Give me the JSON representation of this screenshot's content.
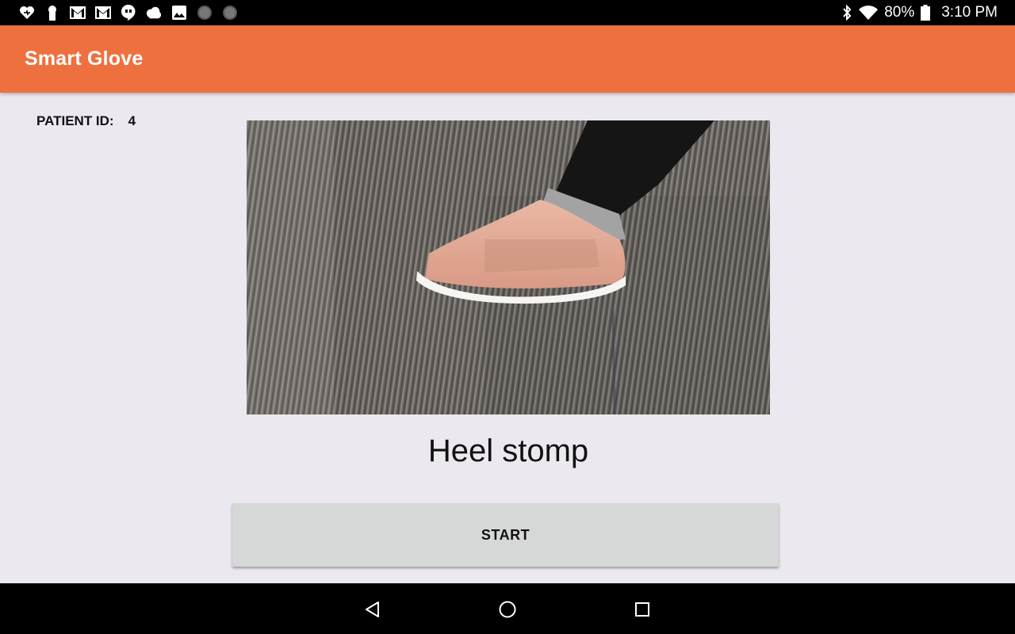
{
  "status_bar": {
    "notification_icons": [
      "heart-icon",
      "keyhole-icon",
      "gmail-icon",
      "gmail-icon",
      "hangouts-icon",
      "cloud-icon",
      "image-icon",
      "circle-icon",
      "circle-icon"
    ],
    "battery": "80%",
    "time": "3:10 PM"
  },
  "app_bar": {
    "title": "Smart Glove",
    "color": "#ef703f"
  },
  "main": {
    "patient_label": "PATIENT ID:",
    "patient_id": "4",
    "image_subject": "foot-in-pink-sneaker-on-carpet",
    "exercise_name": "Heel stomp",
    "start_label": "START"
  },
  "nav_bar": {
    "icons": [
      "back-icon",
      "home-icon",
      "recents-icon"
    ]
  }
}
